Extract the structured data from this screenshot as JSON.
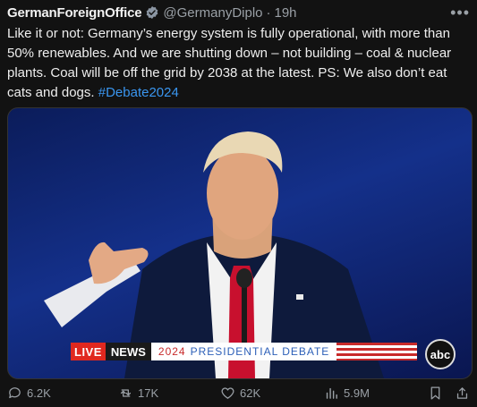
{
  "tweet": {
    "display_name": "GermanForeignOffice",
    "handle": "@GermanyDiplo",
    "separator": "·",
    "time": "19h",
    "more": "•••",
    "text_main": "Like it or not: Germany’s energy system is fully operational, with more than 50% renewables. And we are shutting down – not building – coal & nuclear plants. Coal will be off the grid by 2038 at the latest. PS: We also don’t eat cats and dogs.",
    "hashtag": "#Debate2024"
  },
  "media": {
    "live_label": "LIVE",
    "news_label": "NEWS",
    "debate_year": "2024",
    "debate_title": "PRESIDENTIAL DEBATE",
    "network_logo": "abc"
  },
  "actions": {
    "replies": "6.2K",
    "reposts": "17K",
    "likes": "62K",
    "views": "5.9M"
  },
  "icons": {
    "verified": "verified-badge-icon",
    "reply": "reply-icon",
    "repost": "repost-icon",
    "like": "heart-icon",
    "views": "views-icon",
    "bookmark": "bookmark-icon",
    "share": "share-icon"
  },
  "colors": {
    "background": "#121212",
    "link": "#3a96f0",
    "muted": "#9aa0a6"
  }
}
